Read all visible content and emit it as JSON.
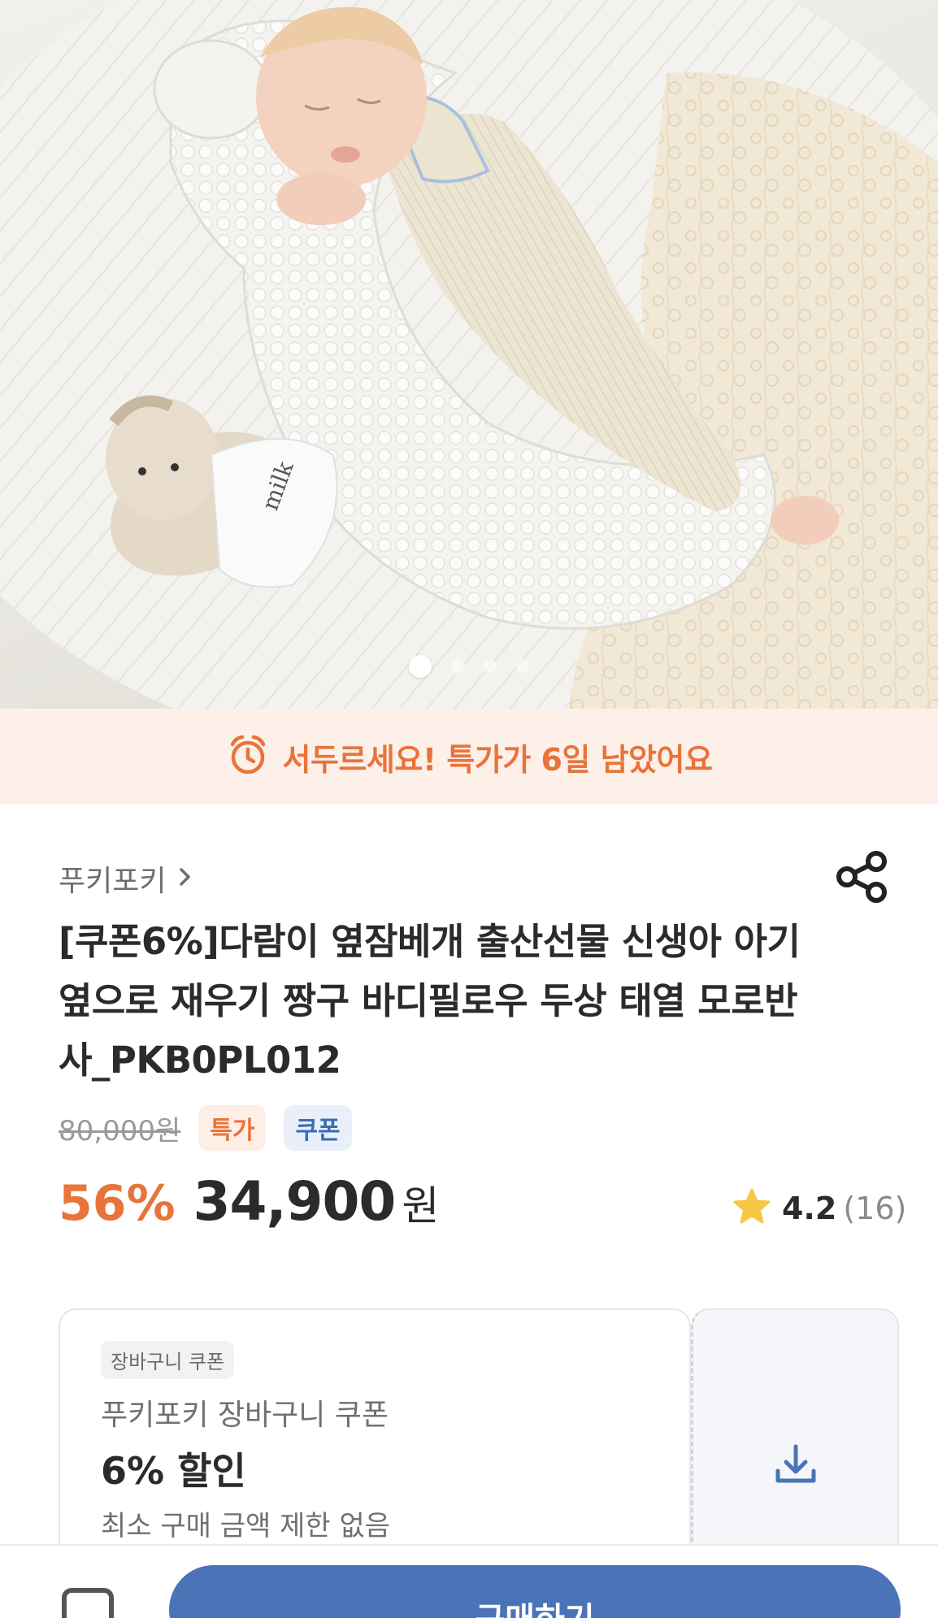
{
  "hero": {
    "slides_total": 4,
    "slide_active": 1
  },
  "banner": {
    "icon": "alarm-clock-icon",
    "text": "서두르세요! 특가가 6일 남았어요",
    "color": "#e8743b",
    "background": "#fdf0e9"
  },
  "product": {
    "brand": "푸키포키",
    "title": "[쿠폰6%]다람이 옆잠베개 출산선물 신생아 아기 옆으로 재우기 짱구 바디필로우 두상 태열 모로반사_PKB0PL012",
    "original_price": "80,000원",
    "tags": [
      "특가",
      "쿠폰"
    ],
    "discount": "56%",
    "price": "34,900",
    "currency": "원",
    "rating": "4.2",
    "review_count": "(16)"
  },
  "coupon": {
    "badge": "장바구니 쿠폰",
    "name": "푸키포키 장바구니 쿠폰",
    "discount": "6% 할인",
    "min_purchase": "최소 구매 금액 제한 없음",
    "download_icon": "download-icon"
  },
  "bottom_bar": {
    "buy_label": "구매하기",
    "accent": "#4a73b8"
  }
}
